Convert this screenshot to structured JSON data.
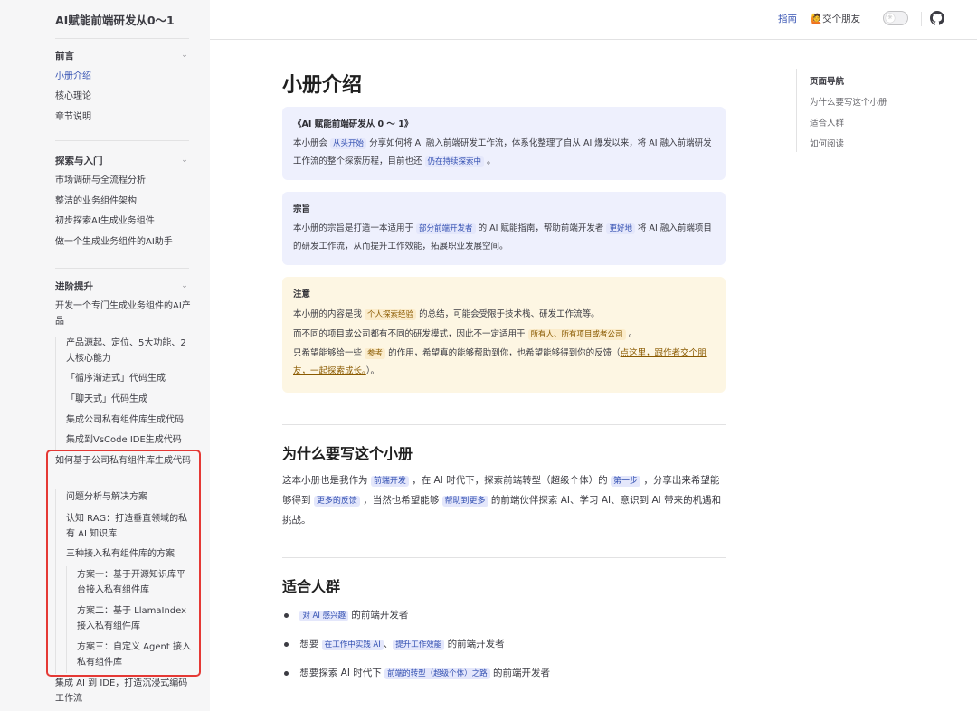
{
  "site": {
    "title": "AI赋能前端研发从0～1"
  },
  "nav": {
    "guide": "指南",
    "friend": "🙋交个朋友",
    "toggle_icon": "☼"
  },
  "sidebar": {
    "groups": [
      {
        "title": "前言",
        "items": [
          "小册介绍",
          "核心理论",
          "章节说明"
        ]
      },
      {
        "title": "探索与入门",
        "items": [
          "市场调研与全流程分析",
          "整洁的业务组件架构",
          "初步探索AI生成业务组件",
          "做一个生成业务组件的AI助手"
        ]
      },
      {
        "title": "进阶提升",
        "items": [
          "开发一个专门生成业务组件的AI产品",
          "产品源起、定位、5大功能、2大核心能力",
          "「循序渐进式」代码生成",
          "「聊天式」代码生成",
          "集成公司私有组件库生成代码",
          "集成到VsCode IDE生成代码",
          "如何基于公司私有组件库生成代码",
          "问题分析与解决方案",
          "认知 RAG：打造垂直领域的私有 AI 知识库",
          "三种接入私有组件库的方案",
          "方案一：基于开源知识库平台接入私有组件库",
          "方案二：基于 LlamaIndex 接入私有组件库",
          "方案三：自定义 Agent 接入私有组件库",
          "集成 AI 到 IDE，打造沉浸式编码工作流"
        ]
      }
    ]
  },
  "main": {
    "title": "小册介绍",
    "intro": {
      "title": "《AI 赋能前端研发从 0 ～ 1》",
      "t1": "本小册会",
      "tag1": "从头开始",
      "t2": "分享如何将 AI 融入前端研发工作流，体系化整理了自从 AI 爆发以来，将 AI 融入前端研发工作流的整个探索历程，目前也还",
      "tag2": "仍在持续探索中",
      "t3": "。"
    },
    "purpose": {
      "title": "宗旨",
      "t1": "本小册的宗旨是打造一本适用于",
      "tag1": "部分前端开发者",
      "t2": "的 AI 赋能指南，帮助前端开发者",
      "tag2": "更好地",
      "t3": "将 AI 融入前端项目的研发工作流，从而提升工作效能，拓展职业发展空间。"
    },
    "notice": {
      "title": "注意",
      "p1a": "本小册的内容是我",
      "p1tag": "个人探索经验",
      "p1b": "的总结，可能会受限于技术栈、研发工作流等。",
      "p2a": "而不同的项目或公司都有不同的研发模式，因此不一定适用于",
      "p2tag": "所有人、所有项目或者公司",
      "p2b": "。",
      "p3a": "只希望能够给一些",
      "p3tag": "参考",
      "p3b": "的作用，希望真的能够帮助到你，也希望能够得到你的反馈（",
      "p3link": "点这里，跟作者交个朋友，一起探索成长。",
      "p3c": "）。"
    },
    "why": {
      "heading": "为什么要写这个小册",
      "t1": "这本小册也是我作为",
      "tag1": "前端开发",
      "t2": "，在 AI 时代下，探索前端转型（超级个体）的",
      "tag2": "第一步",
      "t3": "，分享出来希望能够得到",
      "tag3": "更多的反馈",
      "t4": "，当然也希望能够",
      "tag4": "帮助到更多",
      "t5": "的前端伙伴探索 AI、学习 AI、意识到 AI 带来的机遇和挑战。"
    },
    "audience": {
      "heading": "适合人群",
      "b1tag": "对 AI 感兴趣",
      "b1": "的前端开发者",
      "b2a": "想要",
      "b2tag1": "在工作中实践 AI",
      "b2sep": "、",
      "b2tag2": "提升工作效能",
      "b2b": "的前端开发者",
      "b3a": "想要探索 AI 时代下",
      "b3tag": "前端的转型（超级个体）之路",
      "b3b": "的前端开发者"
    }
  },
  "outline": {
    "title": "页面导航",
    "items": [
      "为什么要写这个小册",
      "适合人群",
      "如何阅读"
    ]
  },
  "colors": {
    "accent": "#3451b2",
    "highlight_box": "#e53935",
    "info_bg": "#eef0fd",
    "warn_bg": "#fdf6e3"
  }
}
